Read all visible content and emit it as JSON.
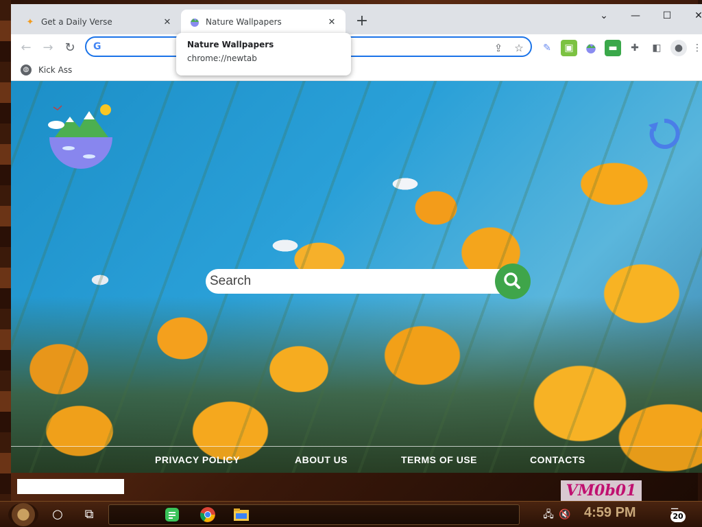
{
  "browser": {
    "tabs": [
      {
        "title": "Get a Daily Verse",
        "favicon": "star-icon",
        "active": false
      },
      {
        "title": "Nature Wallpapers",
        "favicon": "nature-globe-icon",
        "active": true
      }
    ],
    "new_tab_symbol": "+",
    "window_controls": {
      "chevron": "⌄",
      "minimize": "—",
      "maximize": "☐",
      "close": "✕"
    },
    "omnibox": {
      "value": "",
      "placeholder": ""
    },
    "bookmarks": [
      {
        "label": "Kick Ass"
      }
    ],
    "hover_card": {
      "title": "Nature Wallpapers",
      "url": "chrome://newtab"
    }
  },
  "page": {
    "search": {
      "placeholder": "Search"
    },
    "footer_links": [
      {
        "label": "PRIVACY POLICY"
      },
      {
        "label": "ABOUT US"
      },
      {
        "label": "TERMS OF USE"
      },
      {
        "label": "CONTACTS"
      }
    ],
    "colors": {
      "search_button": "#3fa54a",
      "omnibox_border": "#1a73e8"
    }
  },
  "desktop": {
    "vm_label": "VM0b01"
  },
  "taskbar": {
    "clock": "4:59 PM",
    "notification_count": "20"
  }
}
